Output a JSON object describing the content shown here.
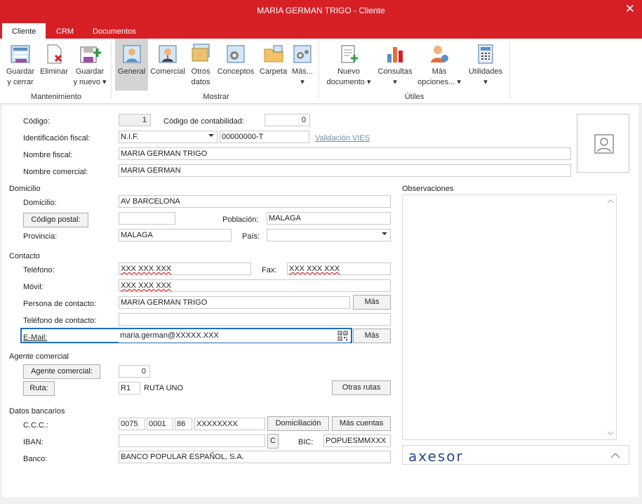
{
  "window": {
    "title": "MARIA GERMAN TRIGO - Cliente",
    "close": "✕"
  },
  "tabs": [
    "Cliente",
    "CRM",
    "Documentos"
  ],
  "ribbon": {
    "buttons": [
      {
        "l1": "Guardar",
        "l2": "y cerrar"
      },
      {
        "l1": "Eliminar",
        "l2": ""
      },
      {
        "l1": "Guardar",
        "l2": "y nuevo ▾"
      },
      {
        "l1": "General",
        "l2": ""
      },
      {
        "l1": "Comercial",
        "l2": ""
      },
      {
        "l1": "Otros",
        "l2": "datos"
      },
      {
        "l1": "Conceptos",
        "l2": ""
      },
      {
        "l1": "Carpeta",
        "l2": ""
      },
      {
        "l1": "Más...",
        "l2": "▾"
      },
      {
        "l1": "Nuevo",
        "l2": "documento ▾"
      },
      {
        "l1": "Consultas",
        "l2": "▾"
      },
      {
        "l1": "Más",
        "l2": "opciones... ▾"
      },
      {
        "l1": "Utilidades",
        "l2": "▾"
      }
    ],
    "groups": [
      "Mantenimiento",
      "Mostrar",
      "Útiles"
    ]
  },
  "form": {
    "codigo_label": "Código:",
    "codigo": "1",
    "cod_contab_label": "Código de contabilidad:",
    "cod_contab": "0",
    "idfiscal_label": "Identificación fiscal:",
    "idfiscal_tipo": "N.I.F.",
    "idfiscal_num": "00000000-T",
    "validacion_vies": "Validación VIES",
    "nombre_fiscal_label": "Nombre fiscal:",
    "nombre_fiscal": "MARIA GERMAN TRIGO",
    "nombre_comercial_label": "Nombre comercial:",
    "nombre_comercial": "MARIA GERMAN",
    "sec_domicilio": "Domicilio",
    "domicilio_label": "Domicilio:",
    "domicilio": "AV BARCELONA",
    "cp_button": "Código postal:",
    "cp": "",
    "poblacion_label": "Población:",
    "poblacion": "MALAGA",
    "provincia_label": "Provincia:",
    "provincia": "MALAGA",
    "pais_label": "País:",
    "pais": "",
    "sec_contacto": "Contacto",
    "telefono_label": "Teléfono:",
    "telefono": "XXX XXX XXX",
    "fax_label": "Fax:",
    "fax": "XXX XXX XXX",
    "movil_label": "Móvil:",
    "movil": "XXX XXX XXX",
    "persona_label": "Persona de contacto:",
    "persona": "MARIA GERMAN TRIGO",
    "mas": "Más",
    "tel_contacto_label": "Teléfono de contacto:",
    "tel_contacto": "",
    "email_label": "E-Mail:",
    "email": "maria.german@XXXXX.XXX",
    "sec_agente": "Agente comercial",
    "agente_button": "Agente comercial:",
    "agente": "0",
    "ruta_button": "Ruta:",
    "ruta_cod": "R1",
    "ruta_nombre": "RUTA UNO",
    "otras_rutas": "Otras rutas",
    "sec_bancarios": "Datos bancarios",
    "ccc_label": "C.C.C.:",
    "ccc1": "0075",
    "ccc2": "0001",
    "ccc3": "86",
    "ccc4": "XXXXXXXX",
    "domiciliacion": "Domiciliación",
    "mas_cuentas": "Más cuentas",
    "iban_label": "IBAN:",
    "iban": "",
    "iban_c": "C",
    "bic_label": "BIC:",
    "bic": "POPUESMMXXX",
    "banco_label": "Banco:",
    "banco": "BANCO POPULAR ESPAÑOL, S.A.",
    "observaciones_label": "Observaciones",
    "axesor": "axesor"
  }
}
